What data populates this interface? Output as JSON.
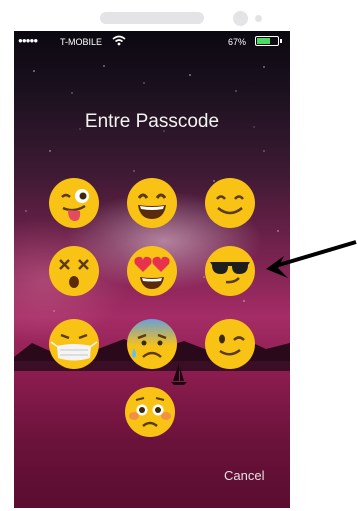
{
  "status_bar": {
    "carrier": "T-MOBILE",
    "signal_icon": "signal-dots-icon",
    "wifi_icon": "wifi-icon",
    "battery_percent": "67%",
    "battery_level": 0.67,
    "battery_color": "#4cd964"
  },
  "lock_screen": {
    "title": "Entre Passcode",
    "cancel_label": "Cancel",
    "keys": [
      {
        "emoji": "winking-tongue-face"
      },
      {
        "emoji": "grinning-face"
      },
      {
        "emoji": "smiling-face"
      },
      {
        "emoji": "dizzy-face"
      },
      {
        "emoji": "heart-eyes-face"
      },
      {
        "emoji": "sunglasses-face"
      },
      {
        "emoji": "medical-mask-face"
      },
      {
        "emoji": "anxious-sweat-face"
      },
      {
        "emoji": "winking-face"
      },
      {
        "emoji": "worried-face"
      }
    ]
  },
  "annotation": {
    "arrow_icon": "arrow-pointer-icon",
    "target": "sunglasses-face"
  }
}
